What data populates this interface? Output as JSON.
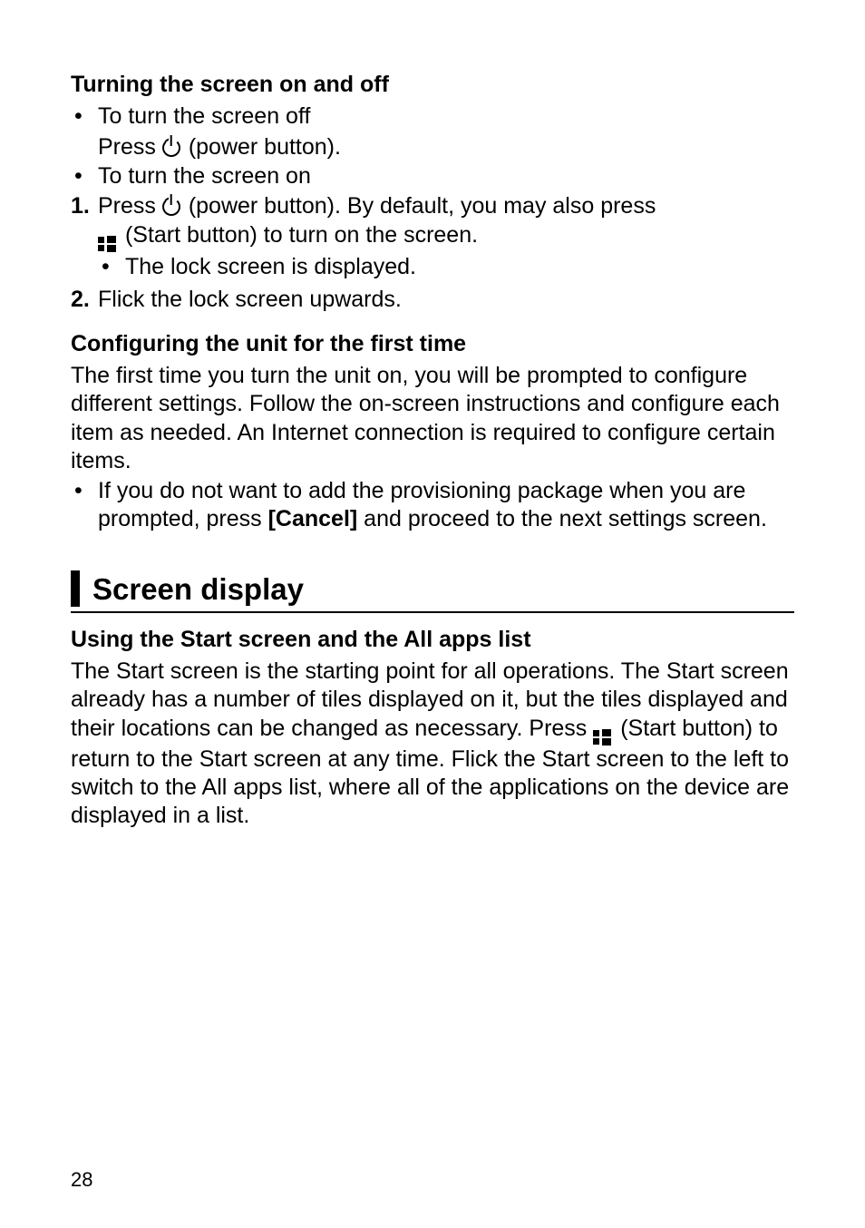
{
  "section1": {
    "heading": "Turning the screen on and off",
    "bullet1": "To turn the screen off",
    "bullet1_line2_a": "Press ",
    "bullet1_line2_b": " (power button).",
    "bullet2": "To turn the screen on",
    "num1_a": "Press ",
    "num1_b": " (power button). By default, you may also press",
    "num1_line2_a": " (Start button) to turn on the screen.",
    "num1_nested": "The lock screen is displayed.",
    "num2": "Flick the lock screen upwards."
  },
  "section2": {
    "heading": "Configuring the unit for the first time",
    "para": "The first time you turn the unit on, you will be prompted to configure different settings. Follow the on-screen instructions and configure each item as needed. An Internet connection is required to configure certain items.",
    "bullet_a": "If you do not want to add the provisioning package when you are prompted, press ",
    "bullet_bold": "[Cancel]",
    "bullet_b": " and proceed to the next settings screen."
  },
  "section3": {
    "title": "Screen display",
    "heading": "Using the Start screen and the All apps list",
    "para_a": "The Start screen is the starting point for all operations. The Start screen already has a number of tiles displayed on it, but the tiles displayed and their locations can be changed as necessary. Press ",
    "para_b": " (Start button) to return to the Start screen at any time. Flick the Start screen to the left to switch to the All apps list, where all of the applications on the device are displayed in a list."
  },
  "pageNumber": "28"
}
